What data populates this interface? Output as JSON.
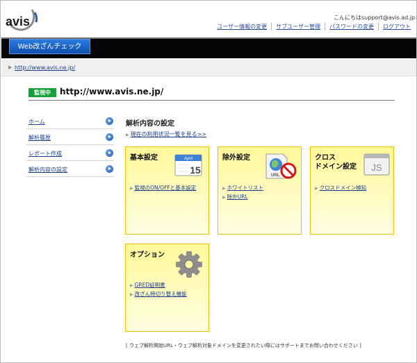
{
  "header": {
    "logo_text": "avis",
    "greeting": "こんにちはsupport@avis.ad.jpさん",
    "links": [
      "ユーザー情報の変更",
      "サブユーザー管理",
      "パスワードの変更",
      "ログアウト"
    ]
  },
  "app_tab": "Web改ざんチェック",
  "breadcrumb_url": "http://www.avis.ne.jp/",
  "site": {
    "badge": "監視中",
    "url": "http://www.avis.ne.jp/"
  },
  "sidebar": {
    "items": [
      {
        "label": "ホーム"
      },
      {
        "label": "解析履歴"
      },
      {
        "label": "レポート作成"
      },
      {
        "label": "解析内容の設定"
      }
    ]
  },
  "main": {
    "title": "解析内容の設定",
    "status_link": "現在の利用状況一覧を見る>>",
    "cards": [
      {
        "title": "基本設定",
        "links": [
          "監視のON/OFFと基本設定"
        ],
        "icon": "calendar-icon",
        "calendar_month": "April",
        "calendar_day": "15"
      },
      {
        "title": "除外設定",
        "links": [
          "ホワイトリスト",
          "除外URL"
        ],
        "icon": "excluded-url-icon",
        "icon_text": "URL"
      },
      {
        "title_line1": "クロス",
        "title_line2": "ドメイン設定",
        "links": [
          "クロスドメイン検知"
        ],
        "icon": "js-window-icon",
        "icon_text": "JS"
      },
      {
        "title": "オプション",
        "links": [
          "GRED証明書",
          "改ざん時切り替え機能"
        ],
        "icon": "gear-icon"
      }
    ]
  },
  "footnote": "[ ウェブ解析開始URL・ウェブ解析対象ドメインを変更されたい際にはサポートまでお問い合わせください ]",
  "colors": {
    "accent_blue": "#1b5aad",
    "badge_green": "#18a13b",
    "card_border": "#f0c000",
    "card_fill": "#fff89a",
    "header_bar": "#050505"
  }
}
